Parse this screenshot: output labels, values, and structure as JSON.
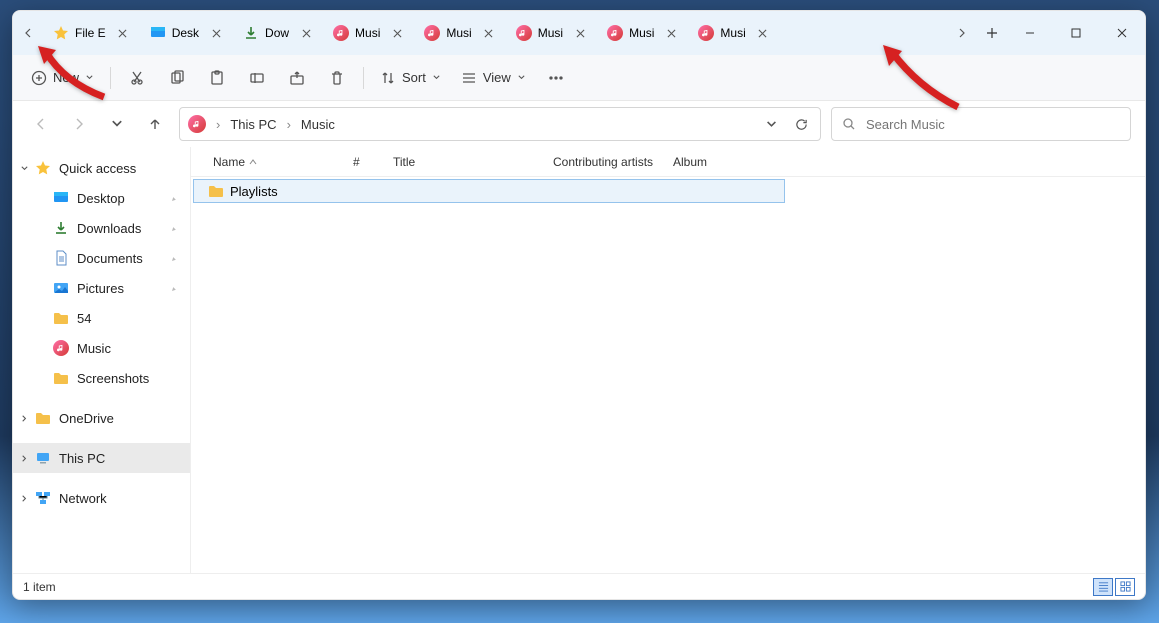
{
  "window_controls": {
    "min": "Minimize",
    "max": "Maximize",
    "close": "Close"
  },
  "tabs": [
    {
      "label": "File E",
      "icon": "star"
    },
    {
      "label": "Desk",
      "icon": "desktop"
    },
    {
      "label": "Dow",
      "icon": "download"
    },
    {
      "label": "Musi",
      "icon": "music"
    },
    {
      "label": "Musi",
      "icon": "music"
    },
    {
      "label": "Musi",
      "icon": "music"
    },
    {
      "label": "Musi",
      "icon": "music"
    },
    {
      "label": "Musi",
      "icon": "music"
    }
  ],
  "toolbar": {
    "new": "New",
    "sort": "Sort",
    "view": "View"
  },
  "breadcrumb": {
    "root": "This PC",
    "leaf": "Music"
  },
  "search": {
    "placeholder": "Search Music"
  },
  "sidebar": {
    "quick": "Quick access",
    "items": [
      {
        "label": "Desktop",
        "icon": "desktop",
        "pinned": true
      },
      {
        "label": "Downloads",
        "icon": "download",
        "pinned": true
      },
      {
        "label": "Documents",
        "icon": "document",
        "pinned": true
      },
      {
        "label": "Pictures",
        "icon": "pictures",
        "pinned": true
      },
      {
        "label": "54",
        "icon": "folder",
        "pinned": false
      },
      {
        "label": "Music",
        "icon": "music",
        "pinned": false
      },
      {
        "label": "Screenshots",
        "icon": "folder",
        "pinned": false
      }
    ],
    "onedrive": "OneDrive",
    "thispc": "This PC",
    "network": "Network"
  },
  "columns": {
    "name": "Name",
    "num": "#",
    "title": "Title",
    "contrib": "Contributing artists",
    "album": "Album"
  },
  "rows": [
    {
      "name": "Playlists"
    }
  ],
  "status": {
    "count": "1 item"
  }
}
